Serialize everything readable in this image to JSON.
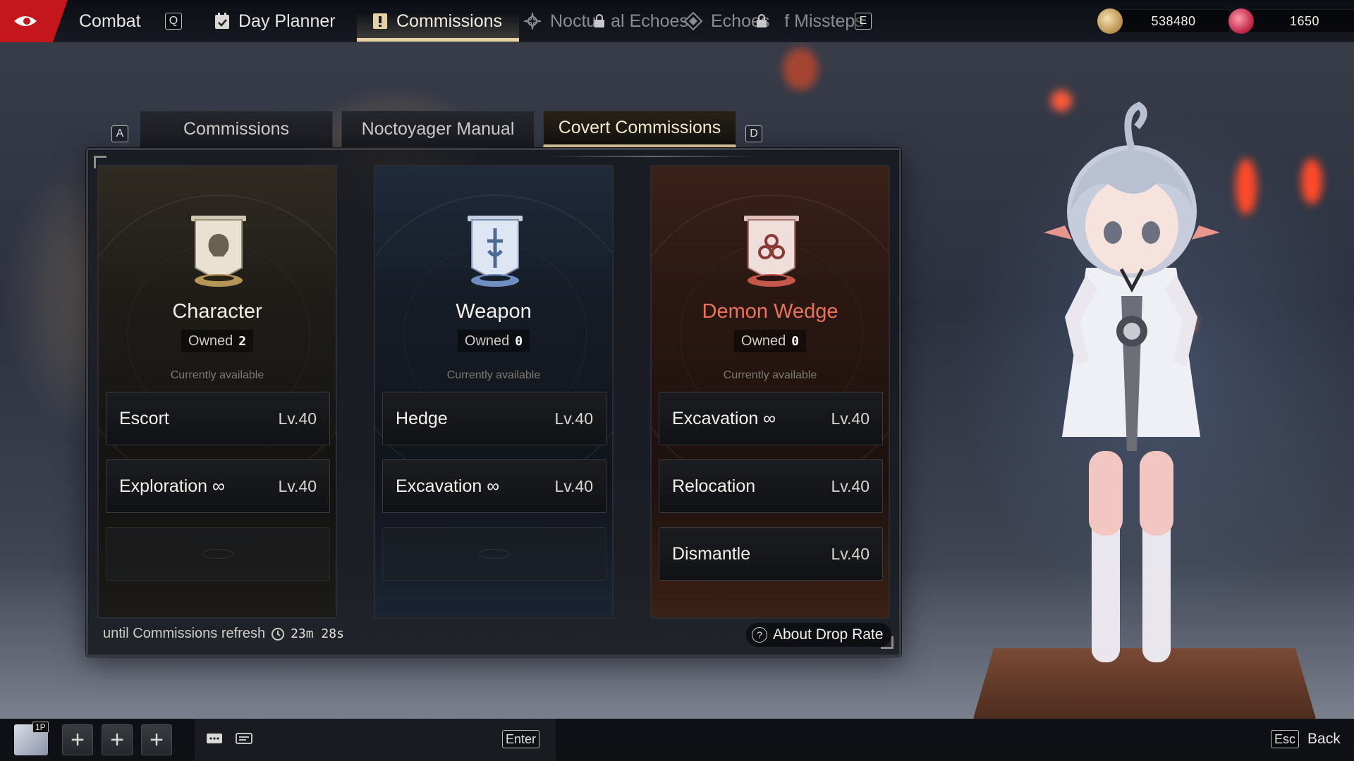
{
  "topbar": {
    "combat_label": "Combat",
    "key_q": "Q",
    "day_planner_label": "Day Planner",
    "commissions_label": "Commissions",
    "nocturnal_echoes_label": "Noctu   al Echoes",
    "echoes_of_missteps_label": "Echoes   f Missteps",
    "key_e": "E",
    "currency_1": "538480",
    "currency_2": "1650"
  },
  "subtabs": {
    "key_a": "A",
    "key_d": "D",
    "items": [
      {
        "label": "Commissions"
      },
      {
        "label": "Noctoyager Manual"
      },
      {
        "label": "Covert Commissions"
      }
    ]
  },
  "columns": [
    {
      "title": "Character",
      "owned_label": "Owned",
      "owned_count": "2",
      "availability": "Currently available",
      "entries": [
        {
          "name": "Escort",
          "level": "Lv.40"
        },
        {
          "name": "Exploration ∞",
          "level": "Lv.40"
        }
      ]
    },
    {
      "title": "Weapon",
      "owned_label": "Owned",
      "owned_count": "0",
      "availability": "Currently available",
      "entries": [
        {
          "name": "Hedge",
          "level": "Lv.40"
        },
        {
          "name": "Excavation ∞",
          "level": "Lv.40"
        }
      ]
    },
    {
      "title": "Demon Wedge",
      "owned_label": "Owned",
      "owned_count": "0",
      "availability": "Currently available",
      "entries": [
        {
          "name": "Excavation ∞",
          "level": "Lv.40"
        },
        {
          "name": "Relocation",
          "level": "Lv.40"
        },
        {
          "name": "Dismantle",
          "level": "Lv.40"
        }
      ]
    }
  ],
  "footer": {
    "refresh_text": "until Commissions refresh",
    "timer": "23m 28s",
    "about_drop_rate": "About Drop Rate",
    "help_glyph": "?"
  },
  "bottombar": {
    "player_tag": "1P",
    "enter_key": "Enter",
    "esc_key": "Esc",
    "back_label": "Back"
  },
  "colors": {
    "accent_gold": "#e6d2a4",
    "brand_red": "#c4161c",
    "demon_title": "#e9735a"
  }
}
